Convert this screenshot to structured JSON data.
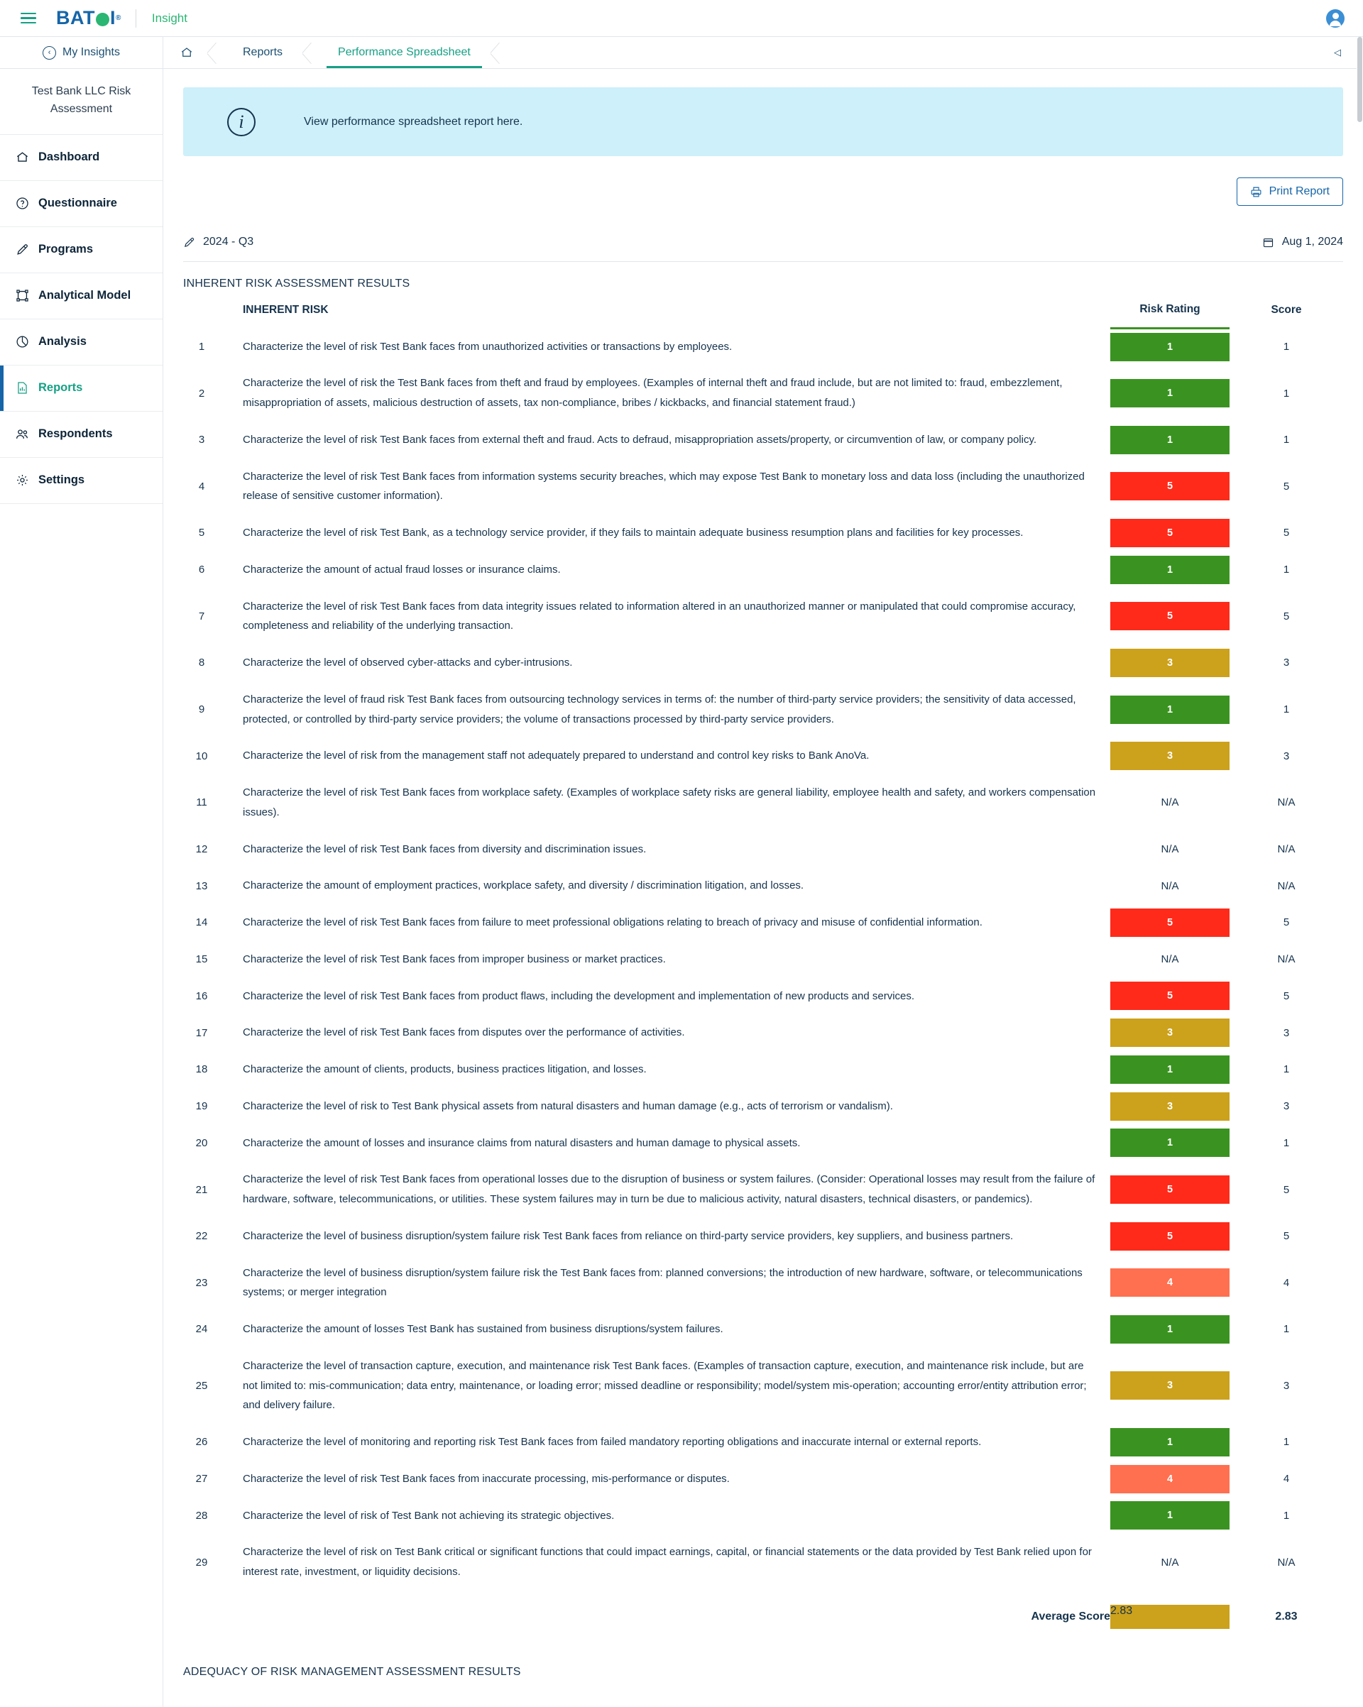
{
  "header": {
    "menu_icon": "hamburger-icon",
    "brand": "BAT",
    "brand_tail": "I",
    "brand_reg": "®",
    "app_name": "Insight",
    "avatar_icon": "user-avatar-icon"
  },
  "breadcrumb": {
    "my_insights": "My Insights",
    "back_icon": "circle-back-arrow-icon",
    "home_icon": "home-icon",
    "items": [
      "Reports",
      "Performance Spreadsheet"
    ],
    "active_index": 1,
    "collapse_icon": "collapse-left-icon"
  },
  "sidebar": {
    "org_title": "Test Bank LLC Risk Assessment",
    "items": [
      {
        "label": "Dashboard",
        "icon": "home-icon",
        "active": false
      },
      {
        "label": "Questionnaire",
        "icon": "question-circle-icon",
        "active": false
      },
      {
        "label": "Programs",
        "icon": "pen-icon",
        "active": false
      },
      {
        "label": "Analytical Model",
        "icon": "model-nodes-icon",
        "active": false
      },
      {
        "label": "Analysis",
        "icon": "pie-chart-icon",
        "active": false
      },
      {
        "label": "Reports",
        "icon": "bar-chart-doc-icon",
        "active": true
      },
      {
        "label": "Respondents",
        "icon": "users-icon",
        "active": false
      },
      {
        "label": "Settings",
        "icon": "gear-icon",
        "active": false
      }
    ]
  },
  "banner": {
    "icon": "info-circle-icon",
    "text": "View performance spreadsheet report here."
  },
  "toolbar": {
    "print_label": "Print Report",
    "print_icon": "printer-icon"
  },
  "meta": {
    "period_icon": "pen-icon",
    "period": "2024 - Q3",
    "date_icon": "calendar-icon",
    "date": "Aug 1, 2024"
  },
  "report": {
    "section_title": "INHERENT RISK ASSESSMENT RESULTS",
    "bottom_section_title": "ADEQUACY OF RISK MANAGEMENT ASSESSMENT RESULTS",
    "columns": [
      "",
      "INHERENT RISK",
      "Risk Rating",
      "Score"
    ],
    "average_label": "Average Score",
    "average_rating": "2.83",
    "average_score": "2.83",
    "average_color": "#cca11c",
    "na_label": "N/A",
    "colors": {
      "1": "#3a9320",
      "3": "#cca11c",
      "4": "#ff7050",
      "5": "#ff2a1a"
    },
    "rows": [
      {
        "num": "1",
        "text": "Characterize the level of risk Test Bank faces from unauthorized activities or transactions by employees.",
        "rating": "1",
        "score": "1"
      },
      {
        "num": "2",
        "text": "Characterize the level of risk the Test Bank faces from theft and fraud by employees. (Examples of internal theft and fraud include, but are not limited to: fraud, embezzlement, misappropriation of assets, malicious destruction of assets, tax non-compliance, bribes / kickbacks, and financial statement fraud.)",
        "rating": "1",
        "score": "1"
      },
      {
        "num": "3",
        "text": "Characterize the level of risk Test Bank faces from external theft and fraud. Acts to defraud, misappropriation assets/property, or circumvention of law, or company policy.",
        "rating": "1",
        "score": "1"
      },
      {
        "num": "4",
        "text": "Characterize the level of risk Test Bank faces from information systems security breaches, which may expose Test Bank to monetary loss and data loss (including the unauthorized release of sensitive customer information).",
        "rating": "5",
        "score": "5"
      },
      {
        "num": "5",
        "text": "Characterize the level of risk Test Bank, as a technology service provider, if they fails to maintain adequate business resumption plans and facilities for key processes.",
        "rating": "5",
        "score": "5"
      },
      {
        "num": "6",
        "text": "Characterize the amount of actual fraud losses or insurance claims.",
        "rating": "1",
        "score": "1"
      },
      {
        "num": "7",
        "text": "Characterize the level of risk Test Bank faces from data integrity issues related to information altered in an unauthorized manner or manipulated that could compromise accuracy, completeness and reliability of the underlying transaction.",
        "rating": "5",
        "score": "5"
      },
      {
        "num": "8",
        "text": "Characterize the level of observed cyber-attacks and cyber-intrusions.",
        "rating": "3",
        "score": "3"
      },
      {
        "num": "9",
        "text": "Characterize the level of fraud risk Test Bank faces from outsourcing technology services in terms of: the number of third-party service providers; the sensitivity of data accessed, protected, or controlled by third-party service providers; the volume of transactions processed by third-party service providers.",
        "rating": "1",
        "score": "1"
      },
      {
        "num": "10",
        "text": "Characterize the level of risk from the management staff not adequately prepared to understand and control key risks to Bank AnoVa.",
        "rating": "3",
        "score": "3"
      },
      {
        "num": "11",
        "text": "Characterize the level of risk Test Bank faces from workplace safety. (Examples of workplace safety risks are general liability, employee health and safety, and workers compensation issues).",
        "rating": "N/A",
        "score": "N/A"
      },
      {
        "num": "12",
        "text": "Characterize the level of risk Test Bank faces from diversity and discrimination issues.",
        "rating": "N/A",
        "score": "N/A"
      },
      {
        "num": "13",
        "text": "Characterize the amount of employment practices, workplace safety, and diversity / discrimination litigation, and losses.",
        "rating": "N/A",
        "score": "N/A"
      },
      {
        "num": "14",
        "text": "Characterize the level of risk Test Bank faces from failure to meet professional obligations relating to breach of privacy and misuse of confidential information.",
        "rating": "5",
        "score": "5"
      },
      {
        "num": "15",
        "text": "Characterize the level of risk Test Bank faces from improper business or market practices.",
        "rating": "N/A",
        "score": "N/A"
      },
      {
        "num": "16",
        "text": "Characterize the level of risk Test Bank faces from product flaws, including the development and implementation of new products and services.",
        "rating": "5",
        "score": "5"
      },
      {
        "num": "17",
        "text": "Characterize the level of risk Test Bank faces from disputes over the performance of activities.",
        "rating": "3",
        "score": "3"
      },
      {
        "num": "18",
        "text": "Characterize the amount of clients, products, business practices litigation, and losses.",
        "rating": "1",
        "score": "1"
      },
      {
        "num": "19",
        "text": "Characterize the level of risk to Test Bank physical assets from natural disasters and human damage (e.g., acts of terrorism or vandalism).",
        "rating": "3",
        "score": "3"
      },
      {
        "num": "20",
        "text": "Characterize the amount of losses and insurance claims from natural disasters and human damage to physical assets.",
        "rating": "1",
        "score": "1"
      },
      {
        "num": "21",
        "text": "Characterize the level of risk Test Bank faces from operational losses due to the disruption of business or system failures. (Consider: Operational losses may result from the failure of hardware, software, telecommunications, or utilities. These system failures may in turn be due to malicious activity, natural disasters, technical disasters, or pandemics).",
        "rating": "5",
        "score": "5"
      },
      {
        "num": "22",
        "text": "Characterize the level of business disruption/system failure risk Test Bank faces from reliance on third-party service providers, key suppliers, and business partners.",
        "rating": "5",
        "score": "5"
      },
      {
        "num": "23",
        "text": "Characterize the level of business disruption/system failure risk the Test Bank faces from: planned conversions; the introduction of new hardware, software, or telecommunications systems; or merger integration",
        "rating": "4",
        "score": "4"
      },
      {
        "num": "24",
        "text": "Characterize the amount of losses Test Bank has sustained from business disruptions/system failures.",
        "rating": "1",
        "score": "1"
      },
      {
        "num": "25",
        "text": "Characterize the level of transaction capture, execution, and maintenance risk Test Bank faces. (Examples of transaction capture, execution, and maintenance risk include, but are not limited to: mis-communication; data entry, maintenance, or loading error; missed deadline or responsibility; model/system mis-operation; accounting error/entity attribution error; and delivery failure.",
        "rating": "3",
        "score": "3"
      },
      {
        "num": "26",
        "text": "Characterize the level of monitoring and reporting risk Test Bank faces from failed mandatory reporting obligations and inaccurate internal or external reports.",
        "rating": "1",
        "score": "1"
      },
      {
        "num": "27",
        "text": "Characterize the level of risk Test Bank faces from inaccurate processing, mis-performance or disputes.",
        "rating": "4",
        "score": "4"
      },
      {
        "num": "28",
        "text": "Characterize the level of risk of Test Bank not achieving its strategic objectives.",
        "rating": "1",
        "score": "1"
      },
      {
        "num": "29",
        "text": "Characterize the level of risk on Test Bank critical or significant functions that could impact earnings, capital, or financial statements or the data provided by Test Bank relied upon for interest rate, investment, or liquidity decisions.",
        "rating": "N/A",
        "score": "N/A"
      }
    ]
  }
}
